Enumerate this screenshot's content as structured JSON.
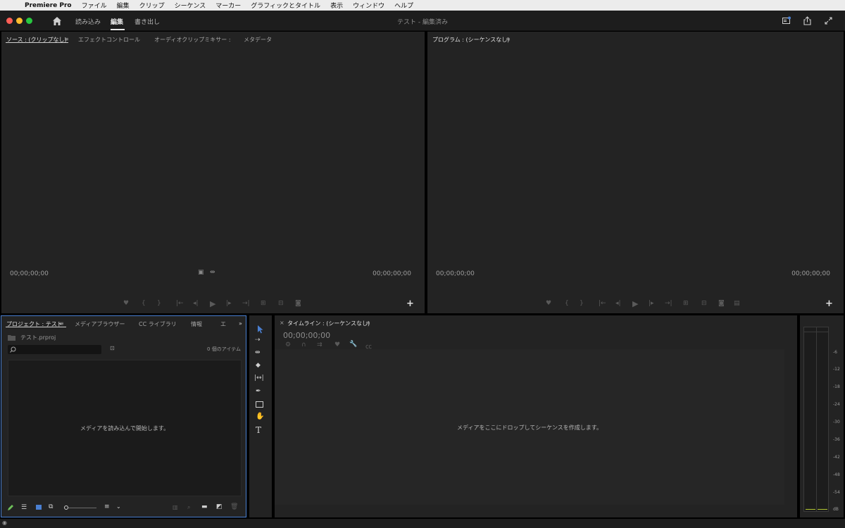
{
  "menubar": {
    "app_name": "Premiere Pro",
    "items": [
      "ファイル",
      "編集",
      "クリップ",
      "シーケンス",
      "マーカー",
      "グラフィックとタイトル",
      "表示",
      "ウィンドウ",
      "ヘルプ"
    ]
  },
  "header": {
    "tabs": [
      "読み込み",
      "編集",
      "書き出し"
    ],
    "active_tab": "編集",
    "title": "テスト - 編集済み"
  },
  "source_panel": {
    "tabs": [
      "ソース : (クリップなし)",
      "エフェクトコントロール",
      "オーディオクリップミキサー :",
      "メタデータ"
    ],
    "timecode_left": "00;00;00;00",
    "timecode_right": "00;00;00;00"
  },
  "program_panel": {
    "tab": "プログラム : (シーケンスなし)",
    "timecode_left": "00;00;00;00",
    "timecode_right": "00;00;00;00"
  },
  "project_panel": {
    "tabs": [
      "プロジェクト : テスト",
      "メディアブラウザー",
      "CC ライブラリ",
      "情報",
      "エ"
    ],
    "project_file": "テスト.prproj",
    "item_count": "0 個のアイテム",
    "empty_message": "メディアを読み込んで開始します。"
  },
  "timeline_panel": {
    "tab": "タイムライン : (シーケンスなし)",
    "timecode": "00;00;00;00",
    "empty_message": "メディアをここにドロップしてシーケンスを作成します。"
  },
  "audio_meter": {
    "ticks": [
      "-6",
      "-12",
      "-18",
      "-24",
      "-30",
      "-36",
      "-42",
      "-48",
      "-54",
      "dB"
    ]
  },
  "colors": {
    "accent_blue": "#4a7fd1",
    "close": "#ff5f57",
    "minimize": "#febc2e",
    "maximize": "#28c840",
    "meter_green": "#b4c832"
  },
  "icons": {
    "home": "home-icon",
    "search": "magnifier-icon",
    "share": "share-icon",
    "fullscreen": "expand-icon"
  }
}
